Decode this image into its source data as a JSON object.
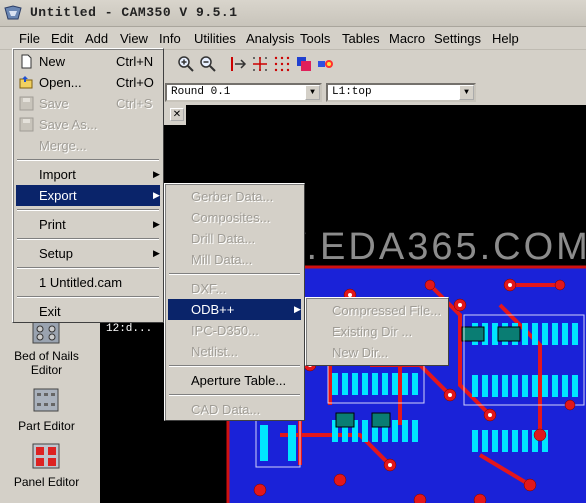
{
  "window": {
    "title": "Untitled - CAM350 V 9.5.1"
  },
  "menubar": [
    "File",
    "Edit",
    "Add",
    "View",
    "Info",
    "Utilities",
    "Analysis",
    "Tools",
    "Tables",
    "Macro",
    "Settings",
    "Help"
  ],
  "toolbar": {
    "aperture_combo": "Round 0.1",
    "layer_combo": "L1:top"
  },
  "file_menu": {
    "new": "New",
    "new_acc": "Ctrl+N",
    "open": "Open...",
    "open_acc": "Ctrl+O",
    "save": "Save",
    "save_acc": "Ctrl+S",
    "save_as": "Save As...",
    "merge": "Merge...",
    "import": "Import",
    "export": "Export",
    "print": "Print",
    "setup": "Setup",
    "recent": "1 Untitled.cam",
    "exit": "Exit"
  },
  "export_menu": {
    "gerber": "Gerber Data...",
    "composites": "Composites...",
    "drill": "Drill Data...",
    "mill": "Mill Data...",
    "dxf": "DXF...",
    "odb": "ODB++",
    "ipc": "IPC-D350...",
    "netlist": "Netlist...",
    "aperture": "Aperture Table...",
    "cad": "CAD Data..."
  },
  "odb_menu": {
    "compressed": "Compressed File...",
    "existing": "Existing Dir ...",
    "newdir": "New Dir..."
  },
  "left_panel": {
    "bed_of_nails": "Bed of Nails Editor",
    "part_editor": "Part Editor",
    "panel_editor": "Panel Editor"
  },
  "viewport": {
    "label": "12:d..."
  },
  "watermark": "WWW.EDA365.COM",
  "colors": {
    "highlight": "#0a246a",
    "menu_bg": "#d4d0c8",
    "pcb_blue": "#1e2be0",
    "pcb_red": "#e2171b",
    "pcb_cyan": "#00e5ff"
  }
}
